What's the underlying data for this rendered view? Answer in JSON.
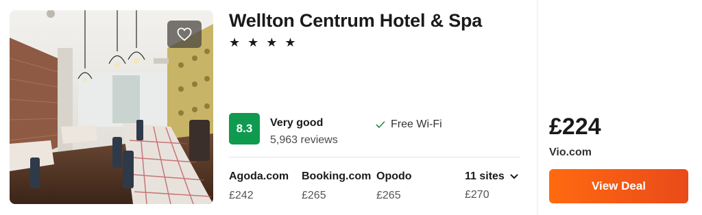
{
  "hotel": {
    "name": "Wellton Centrum Hotel & Spa",
    "stars": "★ ★ ★ ★",
    "star_count": 4,
    "score": "8.3",
    "rating_label": "Very good",
    "reviews": "5,963 reviews",
    "amenity": "Free Wi-Fi",
    "favorite_icon": "heart-icon"
  },
  "offers": [
    {
      "site": "Agoda.com",
      "price": "£242"
    },
    {
      "site": "Booking.com",
      "price": "£265"
    },
    {
      "site": "Opodo",
      "price": "£265"
    }
  ],
  "more_sites": {
    "label": "11 sites",
    "price": "£270",
    "icon": "chevron-down-icon"
  },
  "best_offer": {
    "price": "£224",
    "site": "Vio.com",
    "button_label": "View Deal"
  },
  "colors": {
    "score_bg": "#0f9a4f",
    "check": "#1c8a4b",
    "button_start": "#ff6a10",
    "button_end": "#e94a1a"
  }
}
